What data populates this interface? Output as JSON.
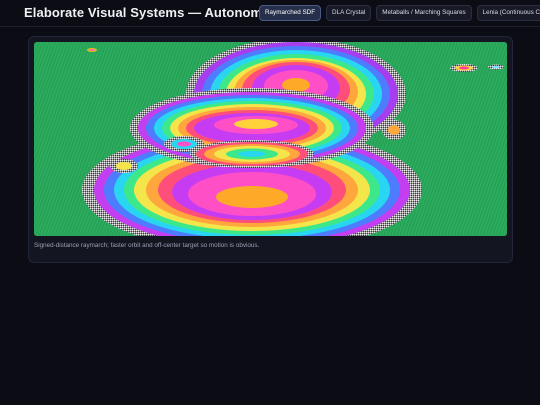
{
  "header": {
    "title": "Elaborate Visual Systems — Autonomous",
    "tabs": [
      {
        "label": "Raymarched SDF",
        "active": true
      },
      {
        "label": "DLA Crystal",
        "active": false
      },
      {
        "label": "Metaballs / Marching Squares",
        "active": false
      },
      {
        "label": "Lenia (Continuous CA)",
        "active": false
      }
    ]
  },
  "main": {
    "caption": "Signed-distance raymarch; faster orbit and off-center target so motion is obvious."
  },
  "colors": {
    "page_bg": "#0c0d14",
    "panel_bg": "#131521",
    "canvas_bg": "#28a85a",
    "active_tab": "#26304a"
  }
}
